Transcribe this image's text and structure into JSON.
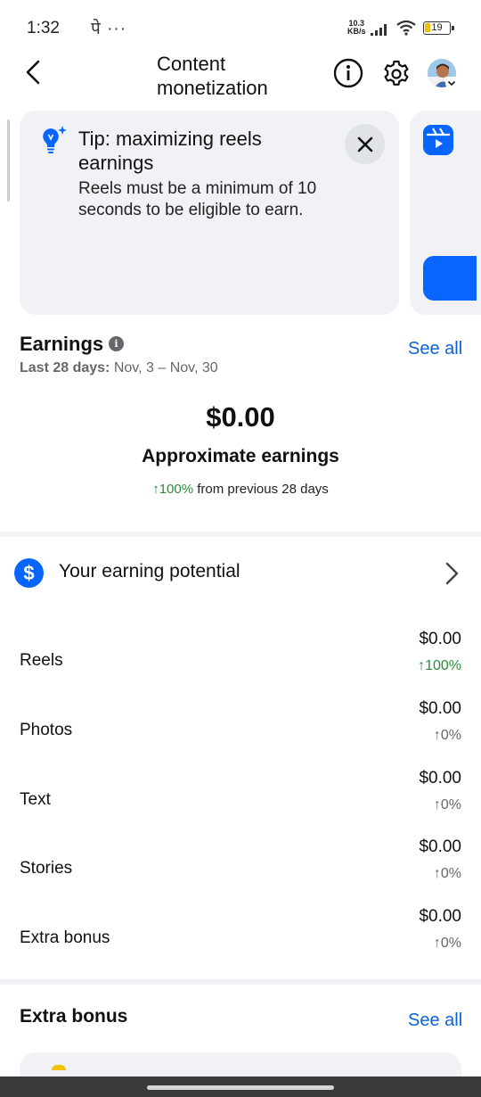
{
  "status_bar": {
    "time": "1:32",
    "carrier_glyph": "पे",
    "more_dots": "···",
    "speed_value": "10.3",
    "speed_unit": "KB/s",
    "battery": "19"
  },
  "header": {
    "title": "Content monetization",
    "icons": [
      "back-arrow-icon",
      "info-icon",
      "gear-icon",
      "avatar"
    ]
  },
  "tip_card": {
    "title": "Tip: maximizing reels earnings",
    "body": "Reels must be a minimum of 10 seconds to be eligible to earn.",
    "icon": "lightbulb-sparkle-icon"
  },
  "earnings": {
    "title": "Earnings",
    "range_label": "Last 28 days:",
    "range_value": "Nov, 3 – Nov, 30",
    "see_all": "See all",
    "amount": "$0.00",
    "amount_label": "Approximate earnings",
    "change_value": "↑100%",
    "change_suffix": " from previous 28 days"
  },
  "potential": {
    "label": "Your earning potential",
    "icon": "dollar-icon"
  },
  "breakdown": [
    {
      "label": "Reels",
      "amount": "$0.00",
      "change": "↑100%"
    },
    {
      "label": "Photos",
      "amount": "$0.00",
      "change": "↑0%"
    },
    {
      "label": "Text",
      "amount": "$0.00",
      "change": "↑0%"
    },
    {
      "label": "Stories",
      "amount": "$0.00",
      "change": "↑0%"
    },
    {
      "label": "Extra bonus",
      "amount": "$0.00",
      "change": "↑0%"
    }
  ],
  "extra_bonus": {
    "title": "Extra bonus",
    "see_all": "See all"
  },
  "colors": {
    "accent_blue": "#0866ff",
    "link_blue": "#0b63d6",
    "positive_green": "#2e8b3a",
    "card_bg": "#f0f2f5"
  }
}
